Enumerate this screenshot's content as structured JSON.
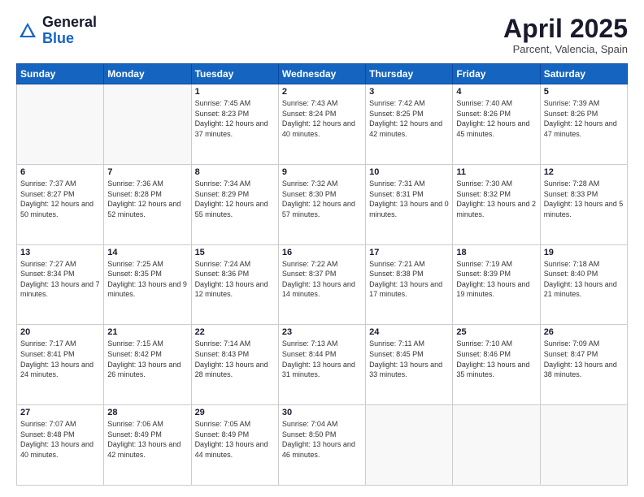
{
  "logo": {
    "general": "General",
    "blue": "Blue"
  },
  "header": {
    "month": "April 2025",
    "location": "Parcent, Valencia, Spain"
  },
  "days_of_week": [
    "Sunday",
    "Monday",
    "Tuesday",
    "Wednesday",
    "Thursday",
    "Friday",
    "Saturday"
  ],
  "weeks": [
    [
      {
        "day": "",
        "info": ""
      },
      {
        "day": "",
        "info": ""
      },
      {
        "day": "1",
        "info": "Sunrise: 7:45 AM\nSunset: 8:23 PM\nDaylight: 12 hours and 37 minutes."
      },
      {
        "day": "2",
        "info": "Sunrise: 7:43 AM\nSunset: 8:24 PM\nDaylight: 12 hours and 40 minutes."
      },
      {
        "day": "3",
        "info": "Sunrise: 7:42 AM\nSunset: 8:25 PM\nDaylight: 12 hours and 42 minutes."
      },
      {
        "day": "4",
        "info": "Sunrise: 7:40 AM\nSunset: 8:26 PM\nDaylight: 12 hours and 45 minutes."
      },
      {
        "day": "5",
        "info": "Sunrise: 7:39 AM\nSunset: 8:26 PM\nDaylight: 12 hours and 47 minutes."
      }
    ],
    [
      {
        "day": "6",
        "info": "Sunrise: 7:37 AM\nSunset: 8:27 PM\nDaylight: 12 hours and 50 minutes."
      },
      {
        "day": "7",
        "info": "Sunrise: 7:36 AM\nSunset: 8:28 PM\nDaylight: 12 hours and 52 minutes."
      },
      {
        "day": "8",
        "info": "Sunrise: 7:34 AM\nSunset: 8:29 PM\nDaylight: 12 hours and 55 minutes."
      },
      {
        "day": "9",
        "info": "Sunrise: 7:32 AM\nSunset: 8:30 PM\nDaylight: 12 hours and 57 minutes."
      },
      {
        "day": "10",
        "info": "Sunrise: 7:31 AM\nSunset: 8:31 PM\nDaylight: 13 hours and 0 minutes."
      },
      {
        "day": "11",
        "info": "Sunrise: 7:30 AM\nSunset: 8:32 PM\nDaylight: 13 hours and 2 minutes."
      },
      {
        "day": "12",
        "info": "Sunrise: 7:28 AM\nSunset: 8:33 PM\nDaylight: 13 hours and 5 minutes."
      }
    ],
    [
      {
        "day": "13",
        "info": "Sunrise: 7:27 AM\nSunset: 8:34 PM\nDaylight: 13 hours and 7 minutes."
      },
      {
        "day": "14",
        "info": "Sunrise: 7:25 AM\nSunset: 8:35 PM\nDaylight: 13 hours and 9 minutes."
      },
      {
        "day": "15",
        "info": "Sunrise: 7:24 AM\nSunset: 8:36 PM\nDaylight: 13 hours and 12 minutes."
      },
      {
        "day": "16",
        "info": "Sunrise: 7:22 AM\nSunset: 8:37 PM\nDaylight: 13 hours and 14 minutes."
      },
      {
        "day": "17",
        "info": "Sunrise: 7:21 AM\nSunset: 8:38 PM\nDaylight: 13 hours and 17 minutes."
      },
      {
        "day": "18",
        "info": "Sunrise: 7:19 AM\nSunset: 8:39 PM\nDaylight: 13 hours and 19 minutes."
      },
      {
        "day": "19",
        "info": "Sunrise: 7:18 AM\nSunset: 8:40 PM\nDaylight: 13 hours and 21 minutes."
      }
    ],
    [
      {
        "day": "20",
        "info": "Sunrise: 7:17 AM\nSunset: 8:41 PM\nDaylight: 13 hours and 24 minutes."
      },
      {
        "day": "21",
        "info": "Sunrise: 7:15 AM\nSunset: 8:42 PM\nDaylight: 13 hours and 26 minutes."
      },
      {
        "day": "22",
        "info": "Sunrise: 7:14 AM\nSunset: 8:43 PM\nDaylight: 13 hours and 28 minutes."
      },
      {
        "day": "23",
        "info": "Sunrise: 7:13 AM\nSunset: 8:44 PM\nDaylight: 13 hours and 31 minutes."
      },
      {
        "day": "24",
        "info": "Sunrise: 7:11 AM\nSunset: 8:45 PM\nDaylight: 13 hours and 33 minutes."
      },
      {
        "day": "25",
        "info": "Sunrise: 7:10 AM\nSunset: 8:46 PM\nDaylight: 13 hours and 35 minutes."
      },
      {
        "day": "26",
        "info": "Sunrise: 7:09 AM\nSunset: 8:47 PM\nDaylight: 13 hours and 38 minutes."
      }
    ],
    [
      {
        "day": "27",
        "info": "Sunrise: 7:07 AM\nSunset: 8:48 PM\nDaylight: 13 hours and 40 minutes."
      },
      {
        "day": "28",
        "info": "Sunrise: 7:06 AM\nSunset: 8:49 PM\nDaylight: 13 hours and 42 minutes."
      },
      {
        "day": "29",
        "info": "Sunrise: 7:05 AM\nSunset: 8:49 PM\nDaylight: 13 hours and 44 minutes."
      },
      {
        "day": "30",
        "info": "Sunrise: 7:04 AM\nSunset: 8:50 PM\nDaylight: 13 hours and 46 minutes."
      },
      {
        "day": "",
        "info": ""
      },
      {
        "day": "",
        "info": ""
      },
      {
        "day": "",
        "info": ""
      }
    ]
  ]
}
